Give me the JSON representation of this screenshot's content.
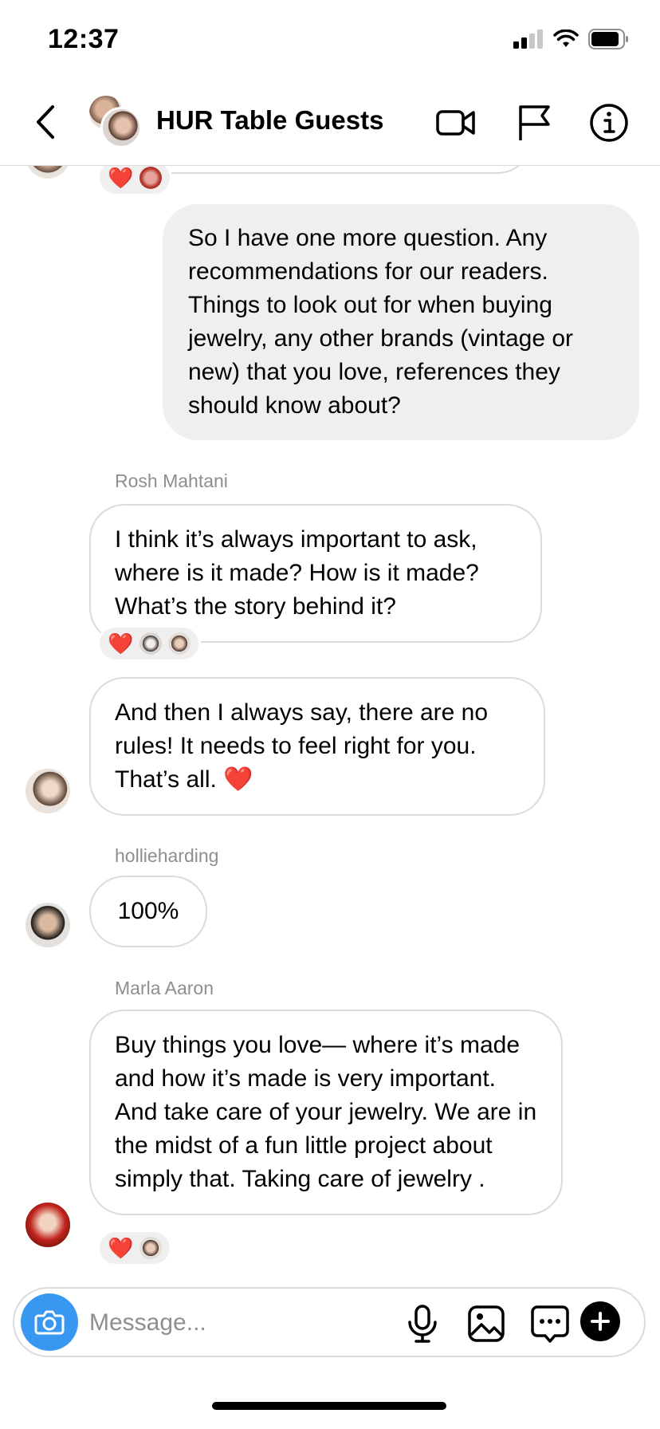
{
  "status_bar": {
    "time": "12:37"
  },
  "header": {
    "title": "HUR Table Guests"
  },
  "messages": [
    {
      "text": "So I have one more question. Any recommendations for our readers. Things to look out for when buying jewelry, any other brands (vintage or new) that you love, references they should know about?"
    },
    {
      "sender": "Rosh Mahtani",
      "text": "I think it’s always important to ask, where is it made? How is it made? What’s the story behind it?"
    },
    {
      "text": "And then I always say, there are no rules! It needs to feel right for you. That’s all. ❤️"
    },
    {
      "sender": "hollieharding",
      "text": "100%"
    },
    {
      "sender": "Marla Aaron",
      "text": "Buy things you love— where it’s made and how it’s made is very important. And take care of your jewelry.  We are in the midst of a fun little project about simply that. Taking care of jewelry ."
    }
  ],
  "reactions": {
    "heart": "❤️"
  },
  "composer": {
    "placeholder": "Message..."
  },
  "colors": {
    "accent": "#3897f0",
    "bubble_out": "#efefef",
    "border": "#dbdbdb",
    "secondary_text": "#8e8e8e",
    "heart": "#e0241f"
  },
  "icons": [
    "back-chevron-icon",
    "video-call-icon",
    "flag-icon",
    "info-icon",
    "camera-icon",
    "microphone-icon",
    "gallery-icon",
    "sticker-chat-icon",
    "plus-icon"
  ]
}
